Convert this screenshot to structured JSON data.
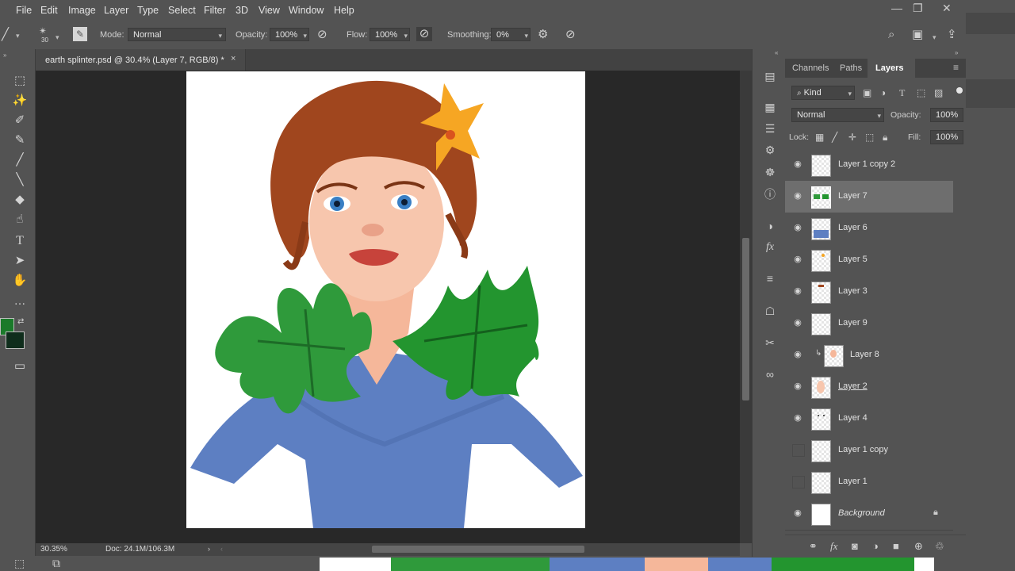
{
  "menu": [
    "File",
    "Edit",
    "Image",
    "Layer",
    "Type",
    "Select",
    "Filter",
    "3D",
    "View",
    "Window",
    "Help"
  ],
  "window_controls": {
    "minimize": "—",
    "restore": "❐",
    "close": "✕"
  },
  "options": {
    "brush_size": "30",
    "mode_label": "Mode:",
    "mode_value": "Normal",
    "opacity_label": "Opacity:",
    "opacity_value": "100%",
    "flow_label": "Flow:",
    "flow_value": "100%",
    "smoothing_label": "Smoothing:",
    "smoothing_value": "0%"
  },
  "document": {
    "tab_title": "earth splinter.psd @ 30.4% (Layer 7, RGB/8) *",
    "tab_close": "×",
    "zoom": "30.35%",
    "doc_size": "Doc: 24.1M/106.3M"
  },
  "colors": {
    "foreground": "#1a7a2a",
    "background": "#0f2d1c"
  },
  "panel": {
    "tabs": [
      "Channels",
      "Paths",
      "Layers"
    ],
    "active_tab": "Layers",
    "filter_kind": "Kind",
    "blend_mode": "Normal",
    "opacity_label": "Opacity:",
    "opacity_value": "100%",
    "lock_label": "Lock:",
    "fill_label": "Fill:",
    "fill_value": "100%"
  },
  "layers": [
    {
      "name": "Layer 1 copy 2",
      "visible": true
    },
    {
      "name": "Layer 7",
      "visible": true,
      "selected": true
    },
    {
      "name": "Layer 6",
      "visible": true
    },
    {
      "name": "Layer 5",
      "visible": true
    },
    {
      "name": "Layer 3",
      "visible": true
    },
    {
      "name": "Layer 9",
      "visible": true
    },
    {
      "name": "Layer 8",
      "visible": true,
      "clipped": true
    },
    {
      "name": "Layer 2",
      "visible": true
    },
    {
      "name": "Layer 4",
      "visible": true
    },
    {
      "name": "Layer 1 copy",
      "visible": false
    },
    {
      "name": "Layer 1",
      "visible": false
    },
    {
      "name": "Background",
      "visible": true,
      "locked": true
    }
  ]
}
